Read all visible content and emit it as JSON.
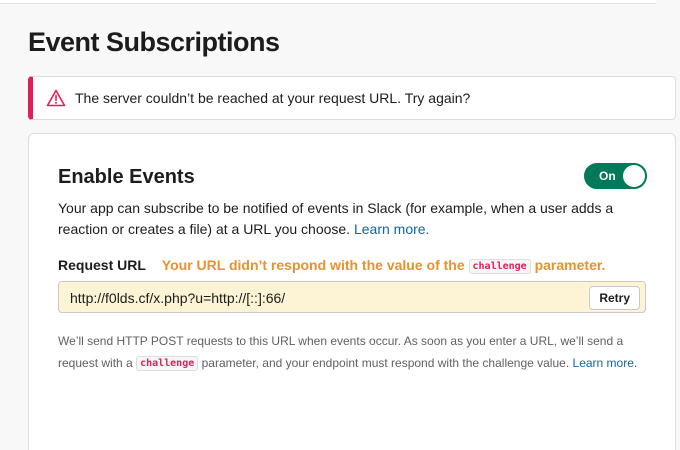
{
  "page": {
    "title": "Event Subscriptions"
  },
  "alert": {
    "icon": "warning-icon",
    "color": "#e01e5a",
    "message": "The server couldn’t be reached at your request URL. Try again?"
  },
  "events_card": {
    "title": "Enable Events",
    "toggle": {
      "label": "On",
      "state": "on",
      "color": "#007a5a"
    },
    "description": "Your app can subscribe to be notified of events in Slack (for example, when a user adds a reaction or creates a file) at a URL you choose.",
    "description_link": "Learn more.",
    "request_url": {
      "label": "Request URL",
      "error_prefix": "Your URL didn’t respond with the value of the",
      "error_code": "challenge",
      "error_suffix": "parameter.",
      "value": "http://f0lds.cf/x.php?u=http://[::]:66/",
      "retry_label": "Retry"
    },
    "help": {
      "part1": "We’ll send HTTP POST requests to this URL when events occur. As soon as you enter a URL, we’ll send a request with a",
      "code": "challenge",
      "part2": "parameter, and your endpoint must respond with the challenge value.",
      "link": "Learn more."
    }
  }
}
